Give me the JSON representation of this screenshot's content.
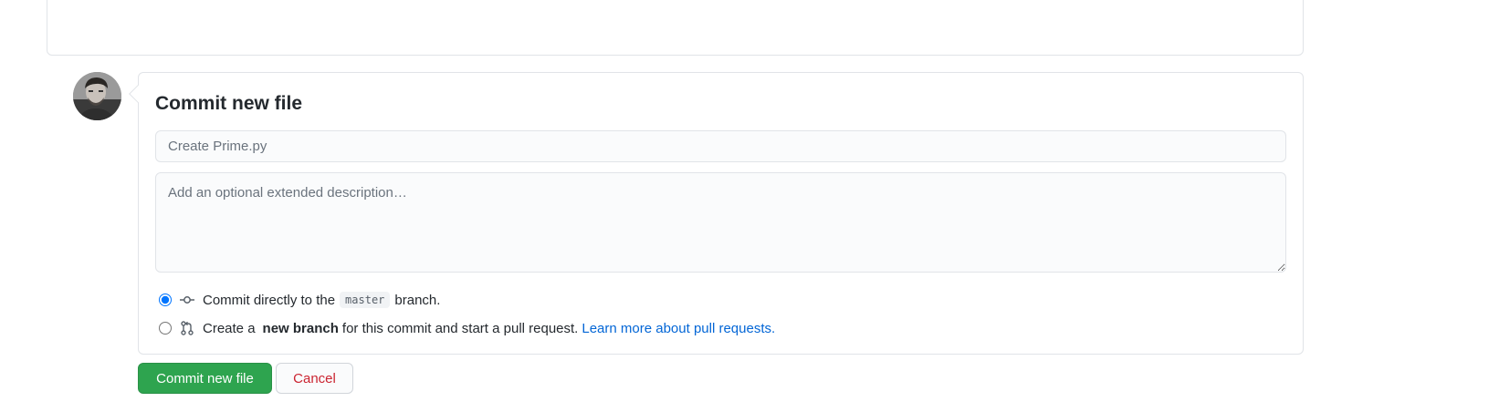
{
  "commit": {
    "title": "Commit new file",
    "summary_placeholder": "Create Prime.py",
    "description_placeholder": "Add an optional extended description…",
    "options": [
      {
        "selected": true,
        "icon": "git-commit-icon",
        "text_before": "Commit directly to the",
        "branch": "master",
        "text_after": "branch."
      },
      {
        "selected": false,
        "icon": "git-pull-request-icon",
        "text_before": "Create a",
        "bold": "new branch",
        "text_after": "for this commit and start a pull request.",
        "link": "Learn more about pull requests."
      }
    ]
  },
  "buttons": {
    "commit_label": "Commit new file",
    "cancel_label": "Cancel"
  },
  "colors": {
    "primary": "#2ea44f",
    "danger": "#cb2431",
    "link": "#0366d6"
  }
}
